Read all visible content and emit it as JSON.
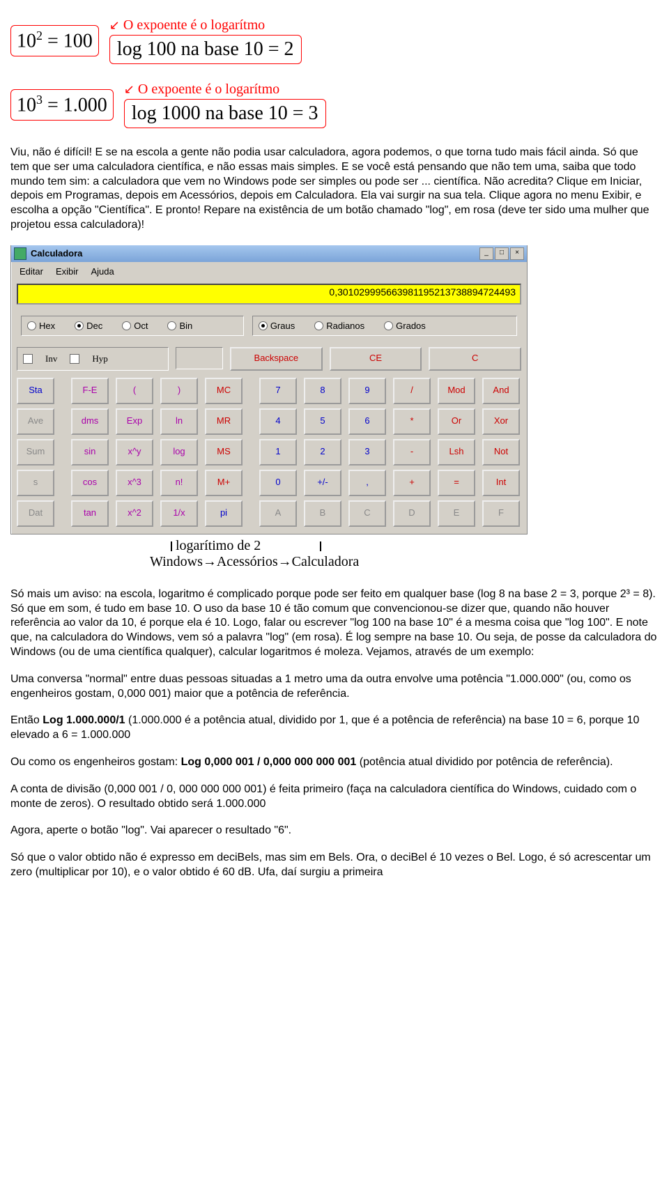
{
  "diagram": {
    "row1": {
      "base": "10",
      "exp": "2",
      "eq": "= 100",
      "log": "log 100 na base 10 = 2",
      "anno": "O expoente é o logarítmo"
    },
    "row2": {
      "base": "10",
      "exp": "3",
      "eq": "= 1.000",
      "log": "log 1000 na base 10 = 3",
      "anno": "O expoente é o logarítmo"
    }
  },
  "para1": "Viu, não é difícil! E se na escola a gente não podia usar calculadora, agora podemos, o que torna tudo mais fácil ainda. Só que tem que ser uma calculadora científica, e não essas mais simples. E se você está pensando que não tem uma, saiba que todo mundo tem sim: a calculadora que vem no Windows pode ser simples ou pode ser ... científica. Não acredita? Clique em Iniciar, depois em Programas, depois em Acessórios, depois em Calculadora. Ela vai surgir na sua tela. Clique agora no menu Exibir, e escolha a opção \"Científica\". E pronto! Repare na existência de um botão chamado \"log\", em rosa (deve ter sido uma mulher que projetou essa calculadora)!",
  "calc": {
    "title": "Calculadora",
    "menu": [
      "Editar",
      "Exibir",
      "Ajuda"
    ],
    "display": "0,301029995663981195213738894724493",
    "winbtns": [
      "_",
      "□",
      "×"
    ],
    "bases": [
      {
        "l": "Hex",
        "sel": false
      },
      {
        "l": "Dec",
        "sel": true
      },
      {
        "l": "Oct",
        "sel": false
      },
      {
        "l": "Bin",
        "sel": false
      }
    ],
    "angles": [
      {
        "l": "Graus",
        "sel": true
      },
      {
        "l": "Radianos",
        "sel": false
      },
      {
        "l": "Grados",
        "sel": false
      }
    ],
    "inv": "Inv",
    "hyp": "Hyp",
    "backspace": "Backspace",
    "ce": "CE",
    "c": "C",
    "grid": [
      [
        "Sta",
        "F-E",
        "(",
        ")",
        "MC",
        "7",
        "8",
        "9",
        "/",
        "Mod",
        "And"
      ],
      [
        "Ave",
        "dms",
        "Exp",
        "ln",
        "MR",
        "4",
        "5",
        "6",
        "*",
        "Or",
        "Xor"
      ],
      [
        "Sum",
        "sin",
        "x^y",
        "log",
        "MS",
        "1",
        "2",
        "3",
        "-",
        "Lsh",
        "Not"
      ],
      [
        "s",
        "cos",
        "x^3",
        "n!",
        "M+",
        "0",
        "+/-",
        ",",
        "+",
        "=",
        "Int"
      ],
      [
        "Dat",
        "tan",
        "x^2",
        "1/x",
        "pi",
        "A",
        "B",
        "C",
        "D",
        "E",
        "F"
      ]
    ],
    "colorMap": {
      "Sta": "blue",
      "Ave": "gray",
      "Sum": "gray",
      "s": "gray",
      "Dat": "gray",
      "F-E": "purple",
      "dms": "purple",
      "sin": "purple",
      "cos": "purple",
      "tan": "purple",
      "(": "purple",
      ")": "purple",
      "Exp": "purple",
      "x^y": "purple",
      "x^3": "purple",
      "x^2": "purple",
      "ln": "purple",
      "log": "purple",
      "n!": "purple",
      "1/x": "purple",
      "pi": "blue",
      "MC": "red",
      "MR": "red",
      "MS": "red",
      "M+": "red",
      "7": "blue",
      "8": "blue",
      "9": "blue",
      "4": "blue",
      "5": "blue",
      "6": "blue",
      "1": "blue",
      "2": "blue",
      "3": "blue",
      "0": "blue",
      "/": "red",
      "*": "red",
      "-": "red",
      "+": "red",
      "+/-": "blue",
      ",": "blue",
      "=": "red",
      "Mod": "red",
      "And": "red",
      "Or": "red",
      "Xor": "red",
      "Lsh": "red",
      "Not": "red",
      "Int": "red",
      "A": "gray",
      "B": "gray",
      "C": "gray",
      "D": "gray",
      "E": "gray",
      "F": "gray"
    }
  },
  "sciLabel1": "logarítimo de 2",
  "sciLabel2": "Windows→Acessórios→Calculadora",
  "para2": "Só mais um aviso: na escola, logaritmo é complicado porque pode ser feito em qualquer base (log 8 na base 2 = 3, porque 2³ = 8). Só que em som, é tudo em base 10. O uso da base 10 é tão comum que convencionou-se dizer que, quando não houver referência ao valor da 10, é porque ela é 10. Logo, falar ou escrever \"log 100 na base 10\" é a mesma coisa que \"log 100\". E note que, na calculadora do Windows, vem só a palavra \"log\" (em rosa). É log sempre na base 10. Ou seja, de posse da calculadora do Windows (ou de uma científica qualquer), calcular logaritmos é moleza. Vejamos, através de um exemplo:",
  "para3": "Uma conversa \"normal\" entre duas pessoas situadas a 1 metro uma da outra envolve uma potência \"1.000.000\" (ou, como os engenheiros gostam, 0,000 001) maior que a potência de referência.",
  "para4a": "Então ",
  "para4b": "Log 1.000.000/1",
  "para4c": " (1.000.000 é a potência atual, dividido por 1, que é a potência de referência) na base 10 = 6, porque 10 elevado a 6 = 1.000.000",
  "para5a": "Ou como os engenheiros gostam: ",
  "para5b": "Log 0,000 001 / 0,000 000 000 001",
  "para5c": " (potência atual dividido por potência de referência).",
  "para6": "A conta de divisão (0,000 001 / 0, 000 000 000 001) é feita primeiro (faça na calculadora científica do Windows, cuidado com o monte de zeros). O resultado obtido será 1.000.000",
  "para7": "Agora, aperte o botão \"log\". Vai aparecer o resultado \"6\".",
  "para8": "Só que o valor obtido não é expresso em deciBels, mas sim em Bels. Ora, o deciBel é 10 vezes o Bel. Logo, é só acrescentar um zero (multiplicar por 10), e o valor obtido é 60 dB. Ufa, daí surgiu a primeira"
}
